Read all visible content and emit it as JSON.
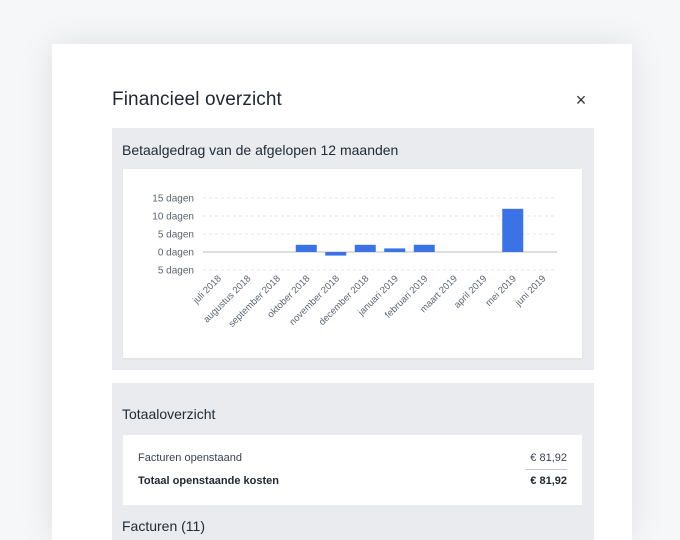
{
  "modal": {
    "title": "Financieel overzicht",
    "close_glyph": "×"
  },
  "betaalgedrag": {
    "title": "Betaalgedrag van de afgelopen 12 maanden"
  },
  "chart_data": {
    "type": "bar",
    "categories": [
      "juli 2018",
      "augustus 2018",
      "september 2018",
      "oktober 2018",
      "november 2018",
      "december 2018",
      "januari 2019",
      "februari 2019",
      "maart 2019",
      "april 2019",
      "mei 2019",
      "juni 2019"
    ],
    "values": [
      0,
      0,
      0,
      2,
      -1,
      2,
      1,
      2,
      0,
      0,
      12,
      0
    ],
    "ylim": [
      -5,
      15
    ],
    "yticks": [
      15,
      10,
      5,
      0,
      -5
    ],
    "ytick_labels": [
      "15 dagen",
      "10 dagen",
      "5 dagen",
      "0 dagen",
      "5 dagen"
    ],
    "bar_color": "#3b73e6",
    "grid": true,
    "title": "",
    "xlabel": "",
    "ylabel": ""
  },
  "totaal": {
    "title": "Totaaloverzicht",
    "rows": [
      {
        "label": "Facturen openstaand",
        "amount": "€ 81,92"
      },
      {
        "label": "Totaal openstaande kosten",
        "amount": "€ 81,92"
      }
    ]
  },
  "facturen": {
    "title": "Facturen (11)"
  }
}
